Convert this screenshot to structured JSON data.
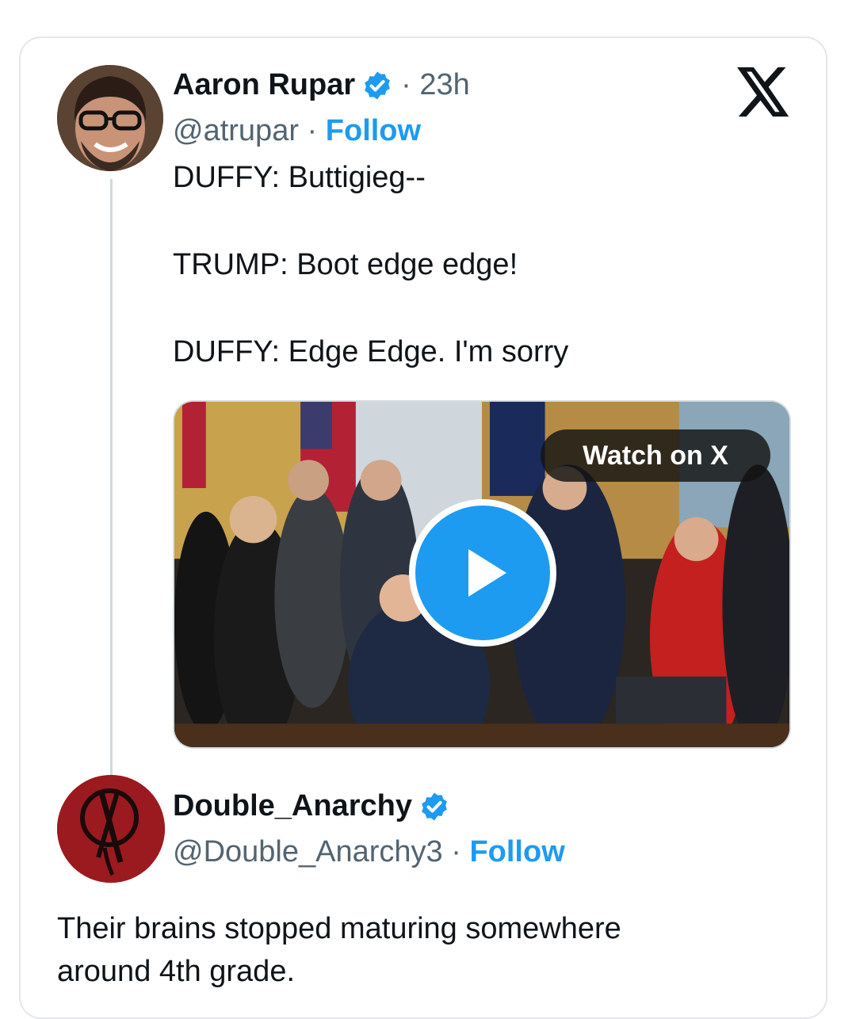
{
  "tweet": {
    "author_name": "Aaron Rupar",
    "time": "23h",
    "handle": "@atrupar",
    "follow_label": "Follow",
    "lines": [
      "DUFFY: Buttigieg--",
      "TRUMP: Boot edge edge!",
      "DUFFY: Edge Edge. I'm sorry"
    ],
    "media": {
      "watch_label": "Watch on X"
    }
  },
  "reply": {
    "author_name": "Double_Anarchy",
    "handle": "@Double_Anarchy3",
    "follow_label": "Follow",
    "lines": [
      "Their brains stopped maturing somewhere",
      "around 4th grade."
    ]
  },
  "colors": {
    "accent": "#1d9bf0",
    "text": "#0f1419",
    "muted": "#536471"
  },
  "icons": [
    "verified-badge-icon",
    "x-logo-icon",
    "play-icon"
  ]
}
